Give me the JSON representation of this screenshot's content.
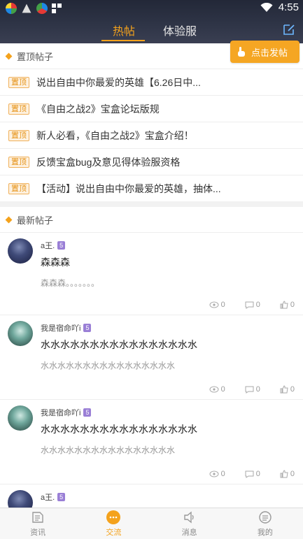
{
  "status_bar": {
    "time": "4:55"
  },
  "header": {
    "tabs": [
      {
        "label": "热帖",
        "active": true
      },
      {
        "label": "体验服",
        "active": false
      }
    ],
    "post_button_label": "点击发帖",
    "accent_color": "#f4a21c"
  },
  "pinned": {
    "title": "置顶帖子",
    "items": [
      {
        "badge": "置顶",
        "text": "说出自由中你最爱的英雄【6.26日中..."
      },
      {
        "badge": "置顶",
        "text": "《自由之战2》宝盒论坛版规"
      },
      {
        "badge": "置顶",
        "text": "新人必看，《自由之战2》宝盒介绍！"
      },
      {
        "badge": "置顶",
        "text": "反馈宝盒bug及意见得体验服资格"
      },
      {
        "badge": "置顶",
        "text": "【活动】说出自由中你最爱的英雄，抽体..."
      }
    ]
  },
  "latest": {
    "title": "最新帖子",
    "posts": [
      {
        "user": "a王.",
        "level": "5",
        "title": "森森森",
        "body": "森森森。。。。。。。",
        "views": "0",
        "comments": "0",
        "likes": "0"
      },
      {
        "user": "我是宿命吖i",
        "level": "5",
        "title": "水水水水水水水水水水水水水水水水",
        "body": "水水水水水水水水水水水水水水水水",
        "views": "0",
        "comments": "0",
        "likes": "0"
      },
      {
        "user": "我是宿命吖i",
        "level": "5",
        "title": "水水水水水水水水水水水水水水水水",
        "body": "水水水水水水水水水水水水水水水水",
        "views": "0",
        "comments": "0",
        "likes": "0"
      },
      {
        "user": "a王.",
        "level": "5",
        "title": "",
        "body": "",
        "views": "",
        "comments": "",
        "likes": ""
      }
    ]
  },
  "bottom_nav": [
    {
      "label": "资讯",
      "icon": "news-icon",
      "active": false
    },
    {
      "label": "交流",
      "icon": "chat-icon",
      "active": true
    },
    {
      "label": "消息",
      "icon": "speaker-icon",
      "active": false
    },
    {
      "label": "我的",
      "icon": "profile-icon",
      "active": false
    }
  ]
}
